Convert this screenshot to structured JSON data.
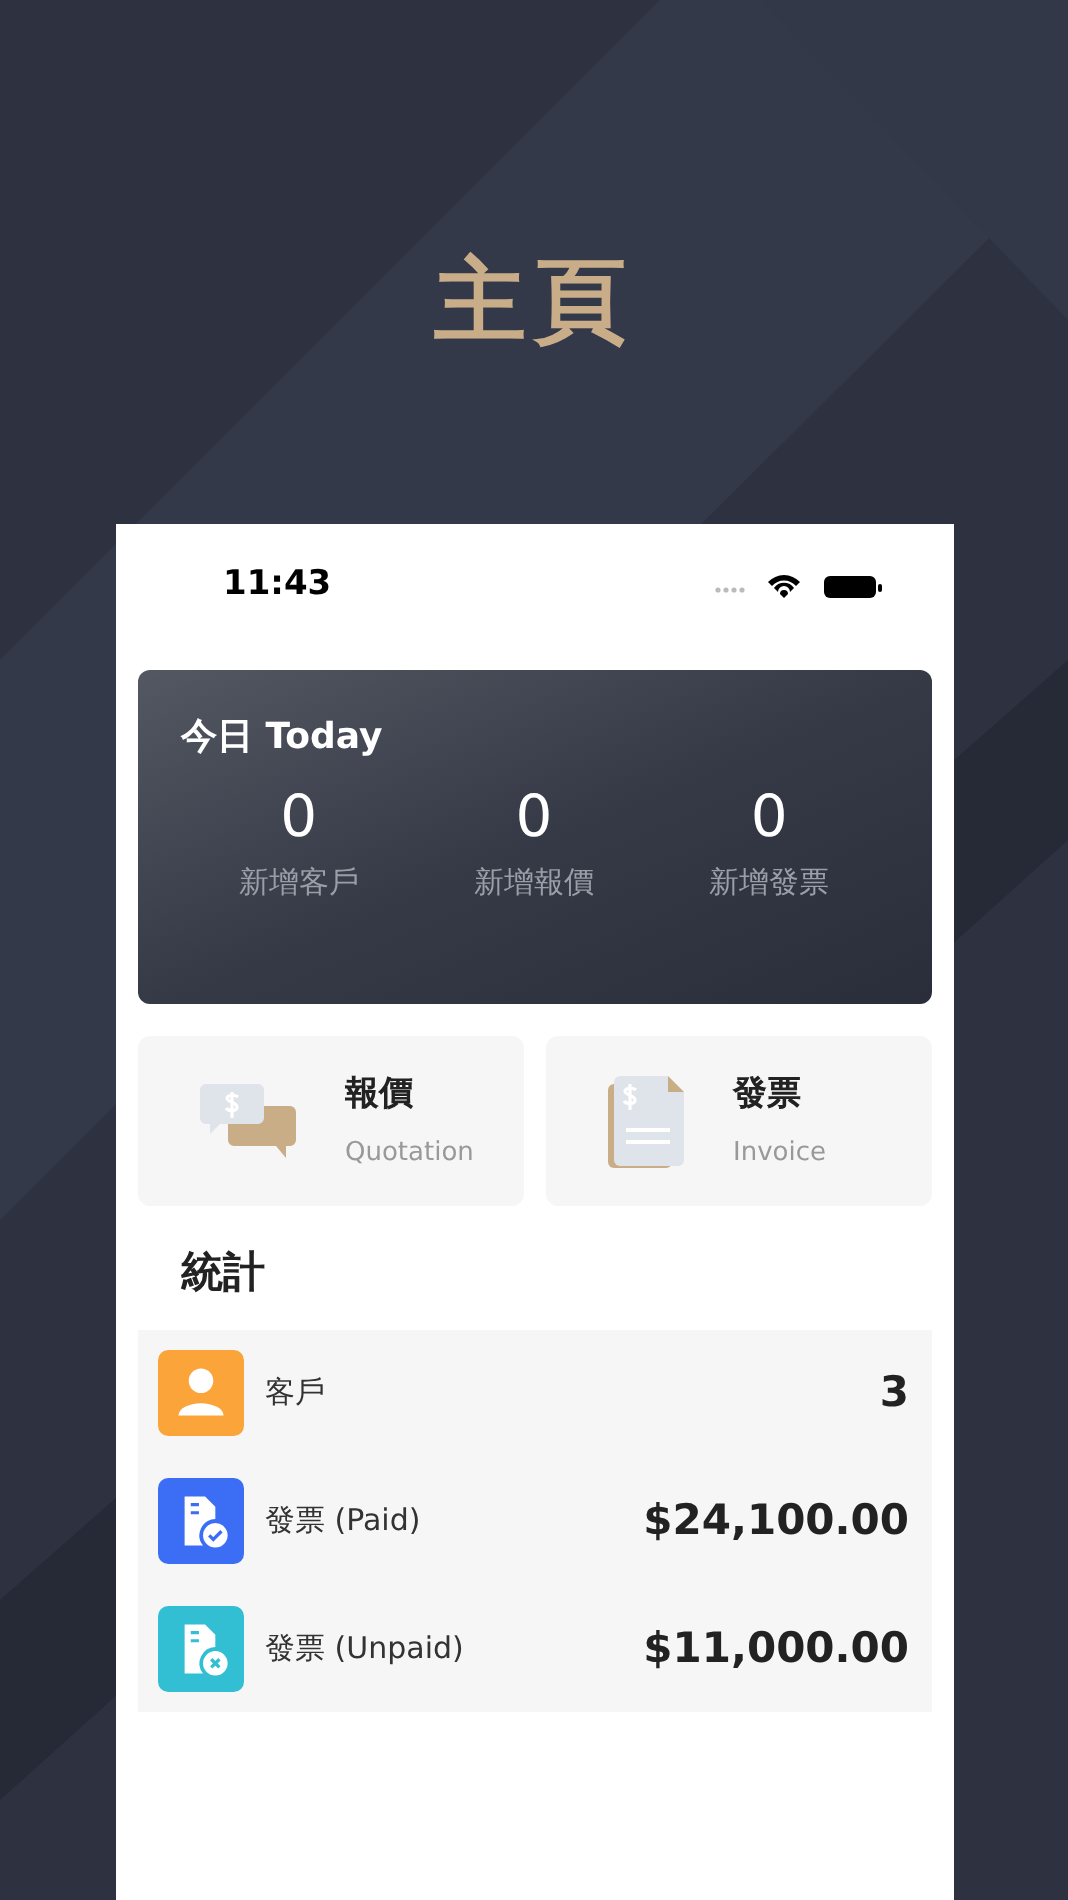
{
  "title": "主頁",
  "status_bar": {
    "time": "11:43"
  },
  "today": {
    "title": "今日 Today",
    "stats": [
      {
        "value": "0",
        "label": "新增客戶"
      },
      {
        "value": "0",
        "label": "新增報價"
      },
      {
        "value": "0",
        "label": "新增發票"
      }
    ]
  },
  "shortcuts": [
    {
      "kind": "quotation",
      "title": "報價",
      "subtitle": "Quotation"
    },
    {
      "kind": "invoice",
      "title": "發票",
      "subtitle": "Invoice"
    }
  ],
  "statistics": {
    "title": "統計",
    "rows": [
      {
        "kind": "person",
        "color": "#fba43a",
        "label": "客戶",
        "value": "3"
      },
      {
        "kind": "paid",
        "color": "#3b6ef5",
        "label": "發票 (Paid)",
        "value": "$24,100.00"
      },
      {
        "kind": "unpaid",
        "color": "#32bfd3",
        "label": "發票 (Unpaid)",
        "value": "$11,000.00"
      }
    ]
  }
}
